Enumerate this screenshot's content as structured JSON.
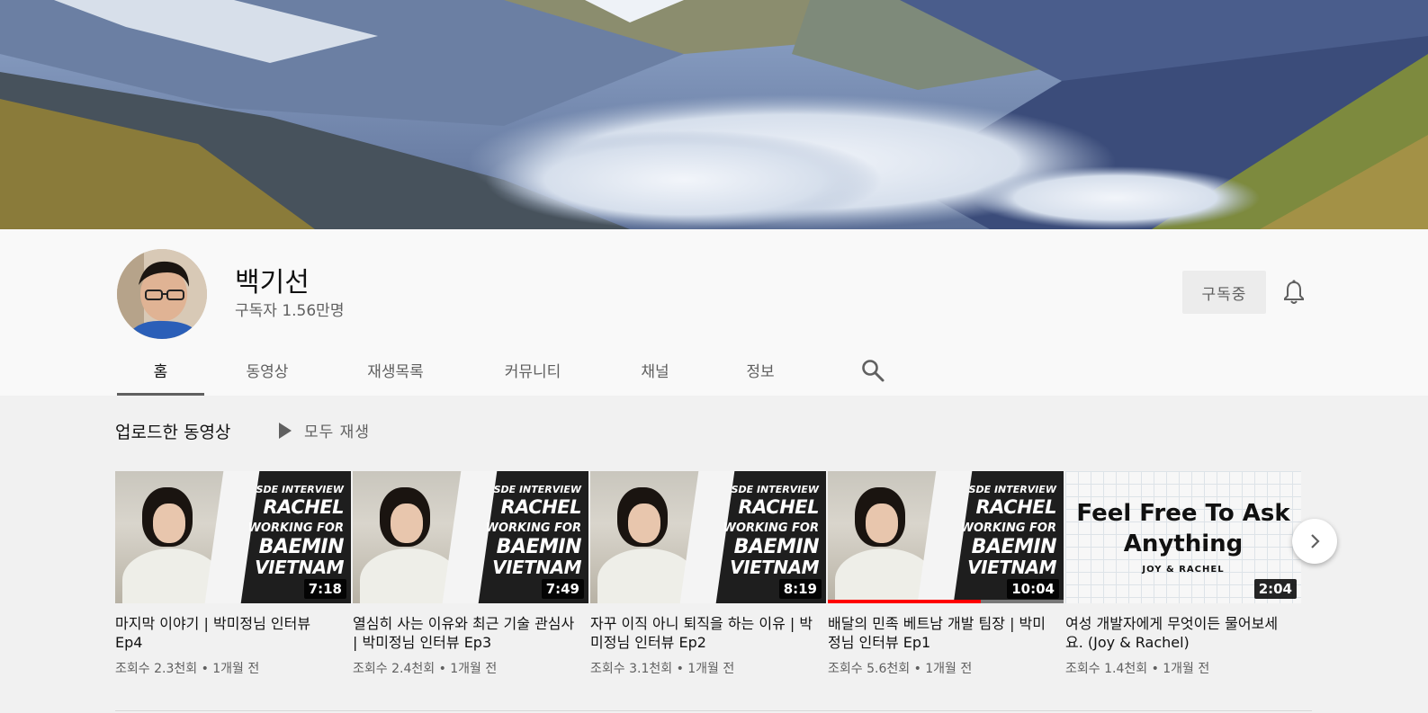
{
  "channel": {
    "name": "백기선",
    "subscribers": "구독자 1.56만명",
    "subscribe_label": "구독중"
  },
  "tabs": [
    {
      "label": "홈",
      "active": true
    },
    {
      "label": "동영상",
      "active": false
    },
    {
      "label": "재생목록",
      "active": false
    },
    {
      "label": "커뮤니티",
      "active": false
    },
    {
      "label": "채널",
      "active": false
    },
    {
      "label": "정보",
      "active": false
    }
  ],
  "section": {
    "title": "업로드한 동영상",
    "play_all": "모두 재생"
  },
  "thumbnail_text": {
    "line1": "SDE INTERVIEW",
    "line2": "RACHEL",
    "line3": "WORKING FOR",
    "line4": "BAEMIN",
    "line5": "VIETNAM",
    "grid_line1": "Feel Free To Ask",
    "grid_line2": "Anything",
    "grid_line3": "JOY & RACHEL"
  },
  "videos": [
    {
      "title": "마지막 이야기 | 박미정님 인터뷰 Ep4",
      "meta": "조회수 2.3천회 • 1개월 전",
      "duration": "7:18",
      "watched": 0
    },
    {
      "title": "열심히 사는 이유와 최근 기술 관심사 | 박미정님 인터뷰 Ep3",
      "meta": "조회수 2.4천회 • 1개월 전",
      "duration": "7:49",
      "watched": 0
    },
    {
      "title": "자꾸 이직 아니 퇴직을 하는 이유 | 박미정님 인터뷰 Ep2",
      "meta": "조회수 3.1천회 • 1개월 전",
      "duration": "8:19",
      "watched": 0
    },
    {
      "title": "배달의 민족 베트남 개발 팀장 | 박미정님 인터뷰 Ep1",
      "meta": "조회수 5.6천회 • 1개월 전",
      "duration": "10:04",
      "watched": 0.65
    },
    {
      "title": "여성 개발자에게 무엇이든 물어보세요. (Joy & Rachel)",
      "meta": "조회수 1.4천회 • 1개월 전",
      "duration": "2:04",
      "watched": 0
    }
  ],
  "colors": {
    "accent": "#ff0000",
    "text_secondary": "#606060"
  }
}
